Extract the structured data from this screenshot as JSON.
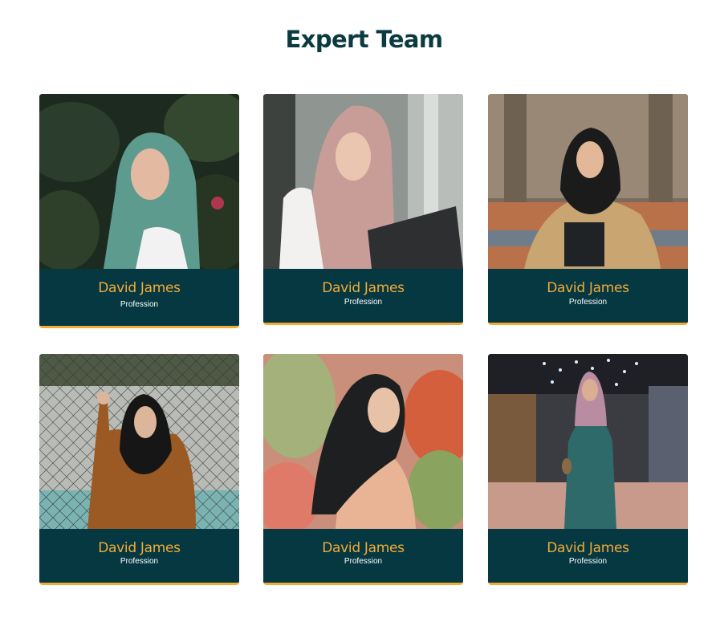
{
  "section": {
    "title": "Expert Team"
  },
  "team": [
    {
      "name": "David James",
      "role": "Profession",
      "photo": "woman-teal-hijab-garden-photo"
    },
    {
      "name": "David James",
      "role": "Profession",
      "photo": "woman-pink-hijab-laptop-photo"
    },
    {
      "name": "David James",
      "role": "Profession",
      "photo": "woman-black-hijab-beige-coat-photo"
    },
    {
      "name": "David James",
      "role": "Profession",
      "photo": "woman-black-hijab-brown-jacket-fence-photo"
    },
    {
      "name": "David James",
      "role": "Profession",
      "photo": "woman-black-hijab-peach-top-photo"
    },
    {
      "name": "David James",
      "role": "Profession",
      "photo": "woman-pink-hijab-green-dress-mall-photo"
    }
  ],
  "colors": {
    "title": "#0b3a40",
    "card_background": "#063842",
    "name": "#f4ab35",
    "role": "#ffffff",
    "accent_border": "#f4ab35"
  }
}
